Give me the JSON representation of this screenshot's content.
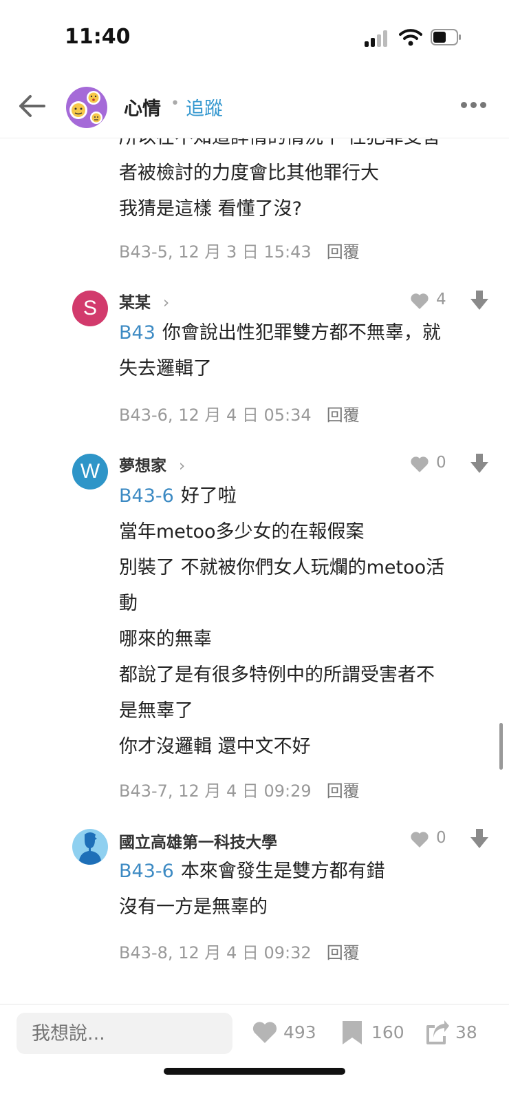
{
  "status_bar": {
    "time": "11:40"
  },
  "header": {
    "board_name": "心情",
    "separator": "•",
    "follow_label": "追蹤"
  },
  "partial_comment": {
    "lines": [
      "所以在不知道詳情的情況下 性犯罪受害",
      "者被檢討的力度會比其他罪行大",
      "我猜是這樣 看懂了沒?"
    ],
    "meta": "B43-5, 12 月 3 日 15:43",
    "reply_label": "回覆"
  },
  "comments": [
    {
      "avatar_letter": "S",
      "avatar_color": "#d23a6c",
      "author": "某某",
      "likes": "4",
      "ref": "B43",
      "lines": [
        "你會說出性犯罪雙方都不無辜，就",
        "失去邏輯了"
      ],
      "meta": "B43-6, 12 月 4 日 05:34",
      "reply_label": "回覆"
    },
    {
      "avatar_letter": "W",
      "avatar_color": "#2e95c8",
      "author": "夢想家",
      "likes": "0",
      "ref": "B43-6",
      "lines": [
        "好了啦",
        "當年metoo多少女的在報假案",
        "別裝了 不就被你們女人玩爛的metoo活",
        "動",
        "哪來的無辜",
        "都說了是有很多特例中的所謂受害者不",
        "是無辜了",
        "你才沒邏輯 還中文不好"
      ],
      "meta": "B43-7, 12 月 4 日 09:29",
      "reply_label": "回覆"
    },
    {
      "avatar_icon": "person-silhouette-icon",
      "avatar_color": "#8fd0f0",
      "author": "國立高雄第一科技大學",
      "likes": "0",
      "ref": "B43-6",
      "lines": [
        "本來會發生是雙方都有錯",
        "沒有一方是無辜的"
      ],
      "meta": "B43-8, 12 月 4 日 09:32",
      "reply_label": "回覆"
    }
  ],
  "bottom_bar": {
    "input_placeholder": "我想說...",
    "like_count": "493",
    "bookmark_count": "160",
    "share_count": "38"
  },
  "colors": {
    "accent": "#3397cf",
    "ref_link": "#3c8ac3",
    "meta_text": "#999999"
  }
}
